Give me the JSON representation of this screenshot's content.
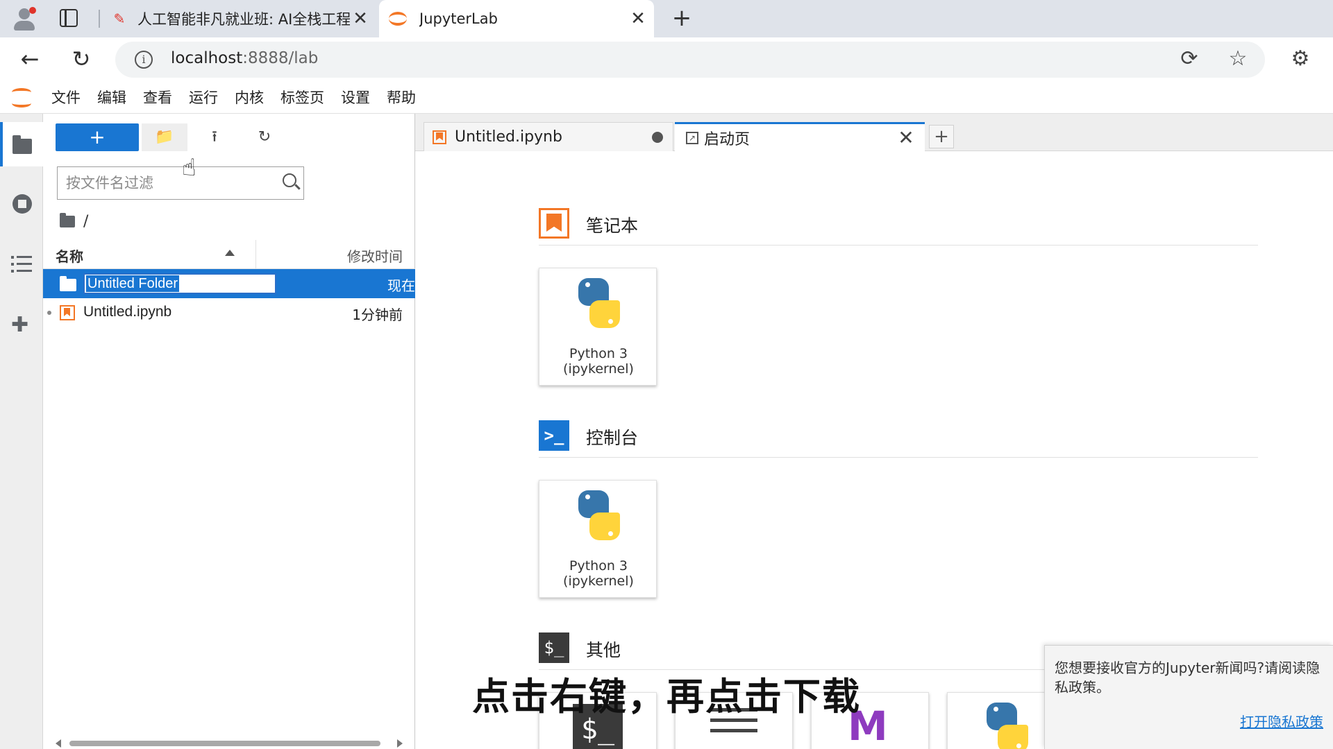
{
  "browser": {
    "tabs": [
      {
        "title": "人工智能非凡就业班: AI全栈工程",
        "icon": "pen-favicon-icon"
      },
      {
        "title": "JupyterLab",
        "icon": "jupyter-favicon-icon"
      }
    ],
    "url": {
      "host": "localhost",
      "path": ":8888/lab"
    }
  },
  "jupyter": {
    "menu": [
      "文件",
      "编辑",
      "查看",
      "运行",
      "内核",
      "标签页",
      "设置",
      "帮助"
    ],
    "filebrowser": {
      "new_label": "+",
      "filter_placeholder": "按文件名过滤",
      "path": "/",
      "columns": {
        "name": "名称",
        "modified": "修改时间"
      },
      "items": [
        {
          "name": "Untitled Folder",
          "modified": "现在",
          "type": "folder",
          "selected": true,
          "renaming": true
        },
        {
          "name": "Untitled.ipynb",
          "modified": "1分钟前",
          "type": "notebook",
          "selected": false
        }
      ]
    },
    "dock_tabs": [
      {
        "label": "Untitled.ipynb",
        "unsaved": true
      },
      {
        "label": "启动页",
        "active": true
      }
    ],
    "launcher": {
      "sections": [
        {
          "title": "笔记本",
          "cards": [
            {
              "line1": "Python 3",
              "line2": "(ipykernel)"
            }
          ]
        },
        {
          "title": "控制台",
          "cards": [
            {
              "line1": "Python 3",
              "line2": "(ipykernel)"
            }
          ]
        },
        {
          "title": "其他"
        }
      ],
      "section_icon_text": {
        "console": ">_",
        "other": "$_"
      },
      "other_card_glyphs": {
        "terminal": "$_",
        "markdown": "M"
      }
    },
    "notification": {
      "message": "您想要接收官方的Jupyter新闻吗?请阅读隐私政策。",
      "action": "打开隐私政策"
    }
  },
  "subtitle": "点击右键，再点击下载",
  "colors": {
    "accent": "#1976d2",
    "jupyter_orange": "#f37726"
  }
}
